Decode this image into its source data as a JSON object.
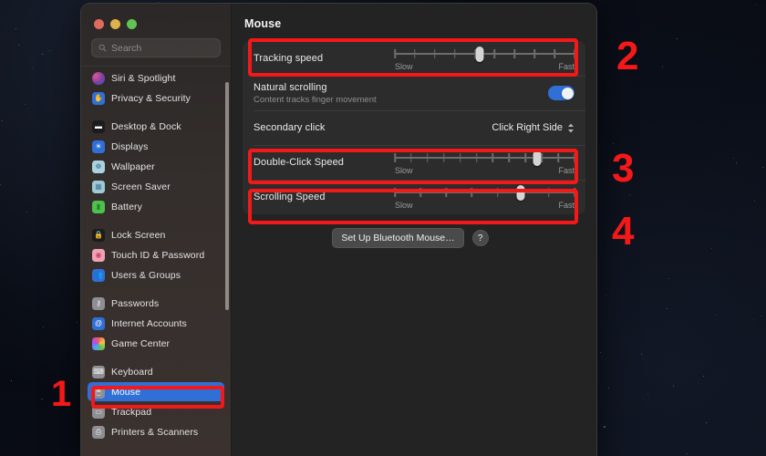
{
  "window": {
    "traffic_lights": [
      "close",
      "minimize",
      "zoom"
    ],
    "search": {
      "placeholder": "Search",
      "icon": "search-icon"
    }
  },
  "sidebar": {
    "items": [
      {
        "label": "Siri & Spotlight",
        "icon": "siri-icon",
        "color": "#7b3fa0",
        "glyph": "",
        "selected": false,
        "gap_before": false
      },
      {
        "label": "Privacy & Security",
        "icon": "privacy-hand-icon",
        "color": "#2f6fd6",
        "glyph": "✋",
        "selected": false,
        "gap_before": false
      },
      {
        "label": "Desktop & Dock",
        "icon": "desktop-dock-icon",
        "color": "#1c1c1e",
        "glyph": "▬",
        "selected": false,
        "gap_before": true
      },
      {
        "label": "Displays",
        "icon": "displays-icon",
        "color": "#2f6fd6",
        "glyph": "☀",
        "selected": false,
        "gap_before": false
      },
      {
        "label": "Wallpaper",
        "icon": "wallpaper-icon",
        "color": "#a9d3e0",
        "glyph": "❁",
        "selected": false,
        "gap_before": false
      },
      {
        "label": "Screen Saver",
        "icon": "screen-saver-icon",
        "color": "#9ec9d8",
        "glyph": "▦",
        "selected": false,
        "gap_before": false
      },
      {
        "label": "Battery",
        "icon": "battery-icon",
        "color": "#4cc14c",
        "glyph": "▮",
        "selected": false,
        "gap_before": false
      },
      {
        "label": "Lock Screen",
        "icon": "lock-screen-icon",
        "color": "#1c1c1e",
        "glyph": "🔒",
        "selected": false,
        "gap_before": true
      },
      {
        "label": "Touch ID & Password",
        "icon": "touch-id-icon",
        "color": "#f2a0b4",
        "glyph": "◉",
        "selected": false,
        "gap_before": false
      },
      {
        "label": "Users & Groups",
        "icon": "users-groups-icon",
        "color": "#2f6fd6",
        "glyph": "👥",
        "selected": false,
        "gap_before": false
      },
      {
        "label": "Passwords",
        "icon": "passwords-key-icon",
        "color": "#8e8e93",
        "glyph": "⚷",
        "selected": false,
        "gap_before": true
      },
      {
        "label": "Internet Accounts",
        "icon": "internet-accounts-icon",
        "color": "#2f6fd6",
        "glyph": "@",
        "selected": false,
        "gap_before": false
      },
      {
        "label": "Game Center",
        "icon": "game-center-icon",
        "color": "#c14ca0",
        "glyph": "✺",
        "selected": false,
        "gap_before": false
      },
      {
        "label": "Keyboard",
        "icon": "keyboard-icon",
        "color": "#8e8e93",
        "glyph": "⌨",
        "selected": false,
        "gap_before": true
      },
      {
        "label": "Mouse",
        "icon": "mouse-icon",
        "color": "#8e8e93",
        "glyph": "🖱",
        "selected": true,
        "gap_before": false
      },
      {
        "label": "Trackpad",
        "icon": "trackpad-icon",
        "color": "#8e8e93",
        "glyph": "▭",
        "selected": false,
        "gap_before": false
      },
      {
        "label": "Printers & Scanners",
        "icon": "printers-scanners-icon",
        "color": "#8e8e93",
        "glyph": "⎙",
        "selected": false,
        "gap_before": false
      }
    ]
  },
  "main": {
    "title": "Mouse",
    "tracking_speed": {
      "label": "Tracking speed",
      "min_label": "Slow",
      "max_label": "Fast",
      "value_pct": 47,
      "ticks": 10
    },
    "natural_scrolling": {
      "label": "Natural scrolling",
      "sublabel": "Content tracks finger movement",
      "enabled": true
    },
    "secondary_click": {
      "label": "Secondary click",
      "value": "Click Right Side"
    },
    "double_click_speed": {
      "label": "Double-Click Speed",
      "min_label": "Slow",
      "max_label": "Fast",
      "value_pct": 79,
      "ticks": 12
    },
    "scrolling_speed": {
      "label": "Scrolling Speed",
      "min_label": "Slow",
      "max_label": "Fast",
      "value_pct": 70,
      "ticks": 8
    },
    "footer": {
      "bluetooth_button": "Set Up Bluetooth Mouse…",
      "help_button": "?"
    }
  },
  "annotations": {
    "color": "#f51818",
    "markers": [
      {
        "number": "1",
        "target": "sidebar-item-mouse"
      },
      {
        "number": "2",
        "target": "tracking-speed-row"
      },
      {
        "number": "3",
        "target": "double-click-speed-row"
      },
      {
        "number": "4",
        "target": "scrolling-speed-row"
      }
    ]
  }
}
